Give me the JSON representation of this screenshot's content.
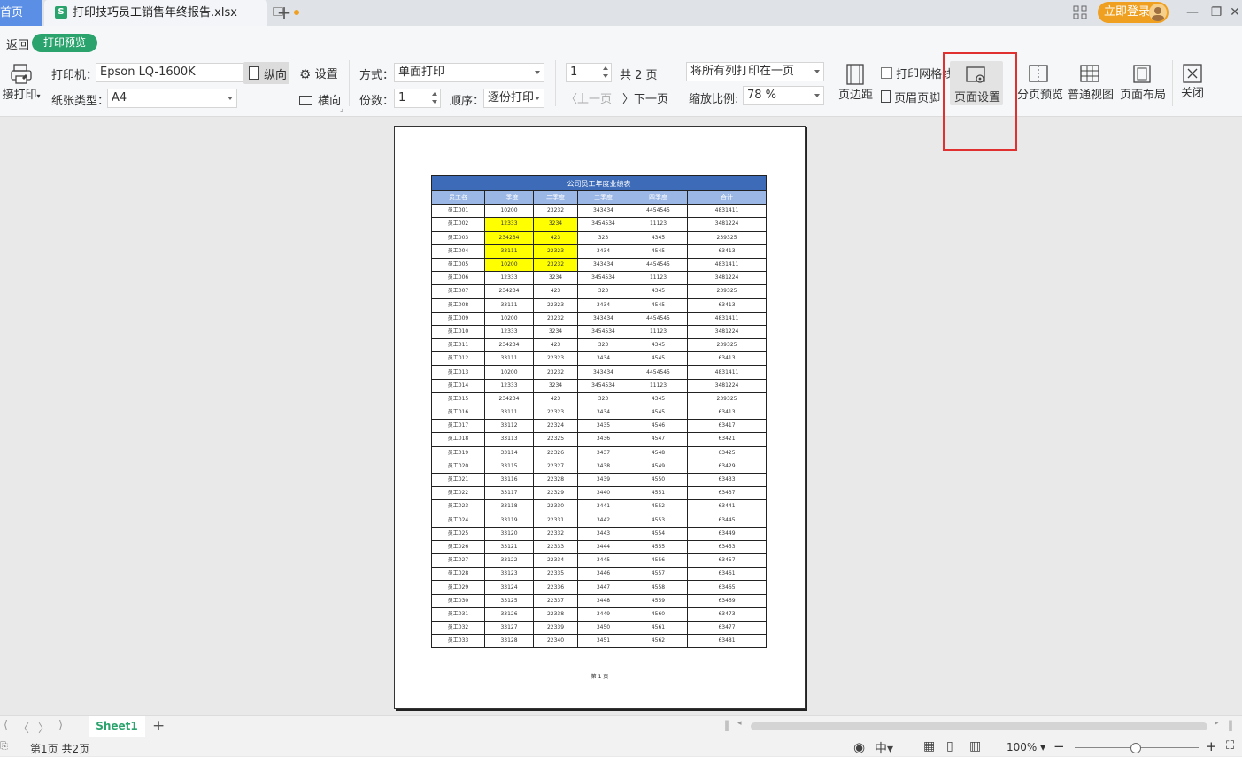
{
  "titlebar": {
    "home_tab": "首页",
    "file_name": "打印技巧员工销售年终报告.xlsx",
    "login_label": "立即登录"
  },
  "ribbon": {
    "back": "返回",
    "print_preview": "打印预览",
    "direct_print": "接打印",
    "printer_label": "打印机：",
    "printer_value": "Epson LQ-1600K",
    "settings": "设置",
    "paper_label": "纸张类型：",
    "paper_value": "A4",
    "portrait": "纵向",
    "landscape": "横向",
    "mode_label": "方式：",
    "mode_value": "单面打印",
    "copies_label": "份数：",
    "copies_value": "1",
    "order_label": "顺序：",
    "order_value": "逐份打印",
    "page_value": "1",
    "total_pages": "共 2 页",
    "prev_page": "上一页",
    "next_page": "下一页",
    "fit_value": "将所有列打印在一页",
    "scale_label": "缩放比例:",
    "scale_value": "78 %",
    "margins": "页边距",
    "print_gridlines": "打印网格线",
    "header_footer": "页眉页脚",
    "page_setup": "页面设置",
    "page_break_preview": "分页预览",
    "normal_view": "普通视图",
    "page_layout": "页面布局",
    "close": "关闭"
  },
  "sheet": {
    "title": "公司员工年度业绩表",
    "headers": [
      "员工名",
      "一季度",
      "二季度",
      "三季度",
      "四季度",
      "合计"
    ],
    "rows": [
      [
        "员工001",
        "10200",
        "23232",
        "343434",
        "4454545",
        "4831411"
      ],
      [
        "员工002",
        "12333",
        "3234",
        "3454534",
        "11123",
        "3481224"
      ],
      [
        "员工003",
        "234234",
        "423",
        "323",
        "4345",
        "239325"
      ],
      [
        "员工004",
        "33111",
        "22323",
        "3434",
        "4545",
        "63413"
      ],
      [
        "员工005",
        "10200",
        "23232",
        "343434",
        "4454545",
        "4831411"
      ],
      [
        "员工006",
        "12333",
        "3234",
        "3454534",
        "11123",
        "3481224"
      ],
      [
        "员工007",
        "234234",
        "423",
        "323",
        "4345",
        "239325"
      ],
      [
        "员工008",
        "33111",
        "22323",
        "3434",
        "4545",
        "63413"
      ],
      [
        "员工009",
        "10200",
        "23232",
        "343434",
        "4454545",
        "4831411"
      ],
      [
        "员工010",
        "12333",
        "3234",
        "3454534",
        "11123",
        "3481224"
      ],
      [
        "员工011",
        "234234",
        "423",
        "323",
        "4345",
        "239325"
      ],
      [
        "员工012",
        "33111",
        "22323",
        "3434",
        "4545",
        "63413"
      ],
      [
        "员工013",
        "10200",
        "23232",
        "343434",
        "4454545",
        "4831411"
      ],
      [
        "员工014",
        "12333",
        "3234",
        "3454534",
        "11123",
        "3481224"
      ],
      [
        "员工015",
        "234234",
        "423",
        "323",
        "4345",
        "239325"
      ],
      [
        "员工016",
        "33111",
        "22323",
        "3434",
        "4545",
        "63413"
      ],
      [
        "员工017",
        "33112",
        "22324",
        "3435",
        "4546",
        "63417"
      ],
      [
        "员工018",
        "33113",
        "22325",
        "3436",
        "4547",
        "63421"
      ],
      [
        "员工019",
        "33114",
        "22326",
        "3437",
        "4548",
        "63425"
      ],
      [
        "员工020",
        "33115",
        "22327",
        "3438",
        "4549",
        "63429"
      ],
      [
        "员工021",
        "33116",
        "22328",
        "3439",
        "4550",
        "63433"
      ],
      [
        "员工022",
        "33117",
        "22329",
        "3440",
        "4551",
        "63437"
      ],
      [
        "员工023",
        "33118",
        "22330",
        "3441",
        "4552",
        "63441"
      ],
      [
        "员工024",
        "33119",
        "22331",
        "3442",
        "4553",
        "63445"
      ],
      [
        "员工025",
        "33120",
        "22332",
        "3443",
        "4554",
        "63449"
      ],
      [
        "员工026",
        "33121",
        "22333",
        "3444",
        "4555",
        "63453"
      ],
      [
        "员工027",
        "33122",
        "22334",
        "3445",
        "4556",
        "63457"
      ],
      [
        "员工028",
        "33123",
        "22335",
        "3446",
        "4557",
        "63461"
      ],
      [
        "员工029",
        "33124",
        "22336",
        "3447",
        "4558",
        "63465"
      ],
      [
        "员工030",
        "33125",
        "22337",
        "3448",
        "4559",
        "63469"
      ],
      [
        "员工031",
        "33126",
        "22338",
        "3449",
        "4560",
        "63473"
      ],
      [
        "员工032",
        "33127",
        "22339",
        "3450",
        "4561",
        "63477"
      ],
      [
        "员工033",
        "33128",
        "22340",
        "3451",
        "4562",
        "63481"
      ]
    ],
    "highlight_color": "#ffff00",
    "header_color": "#3d6bb8",
    "page_footer": "第 1 页"
  },
  "tabs": {
    "sheet_name": "Sheet1"
  },
  "status": {
    "page_info": "第1页 共2页",
    "zoom": "100%"
  },
  "colors": {
    "accent": "#2aa36d",
    "login": "#f0a020",
    "home_tab": "#5b8fe6",
    "highlight_border": "#e03030"
  }
}
